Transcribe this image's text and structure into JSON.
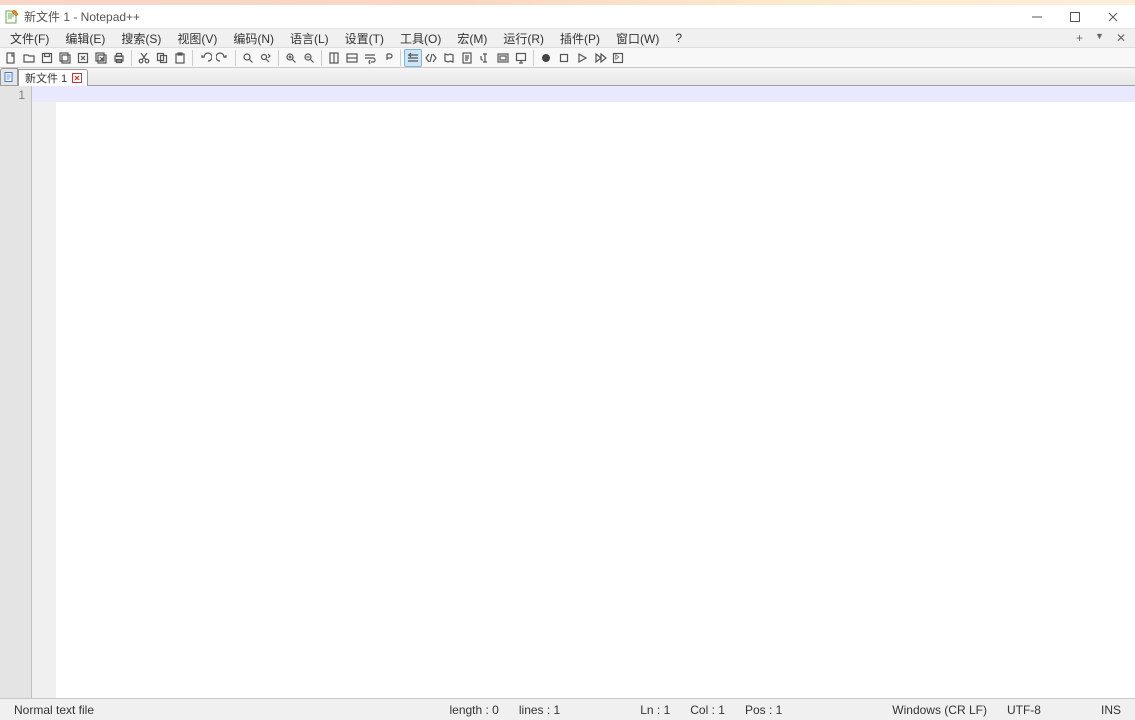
{
  "title": "新文件 1 - Notepad++",
  "menus": {
    "file": "文件(F)",
    "edit": "编辑(E)",
    "search": "搜索(S)",
    "view": "视图(V)",
    "encoding": "编码(N)",
    "language": "语言(L)",
    "settings": "设置(T)",
    "tools": "工具(O)",
    "macro": "宏(M)",
    "run": "运行(R)",
    "plugins": "插件(P)",
    "window": "窗口(W)",
    "help": "?"
  },
  "menu_right": {
    "plus": "+",
    "tri": "▼",
    "x": "✕"
  },
  "tab": {
    "label": "新文件 1"
  },
  "gutter": {
    "line1": "1"
  },
  "status": {
    "filetype": "Normal text file",
    "length": "length : 0",
    "lines": "lines : 1",
    "ln": "Ln : 1",
    "col": "Col : 1",
    "pos": "Pos : 1",
    "eol": "Windows (CR LF)",
    "enc": "UTF-8",
    "ins": "INS"
  }
}
